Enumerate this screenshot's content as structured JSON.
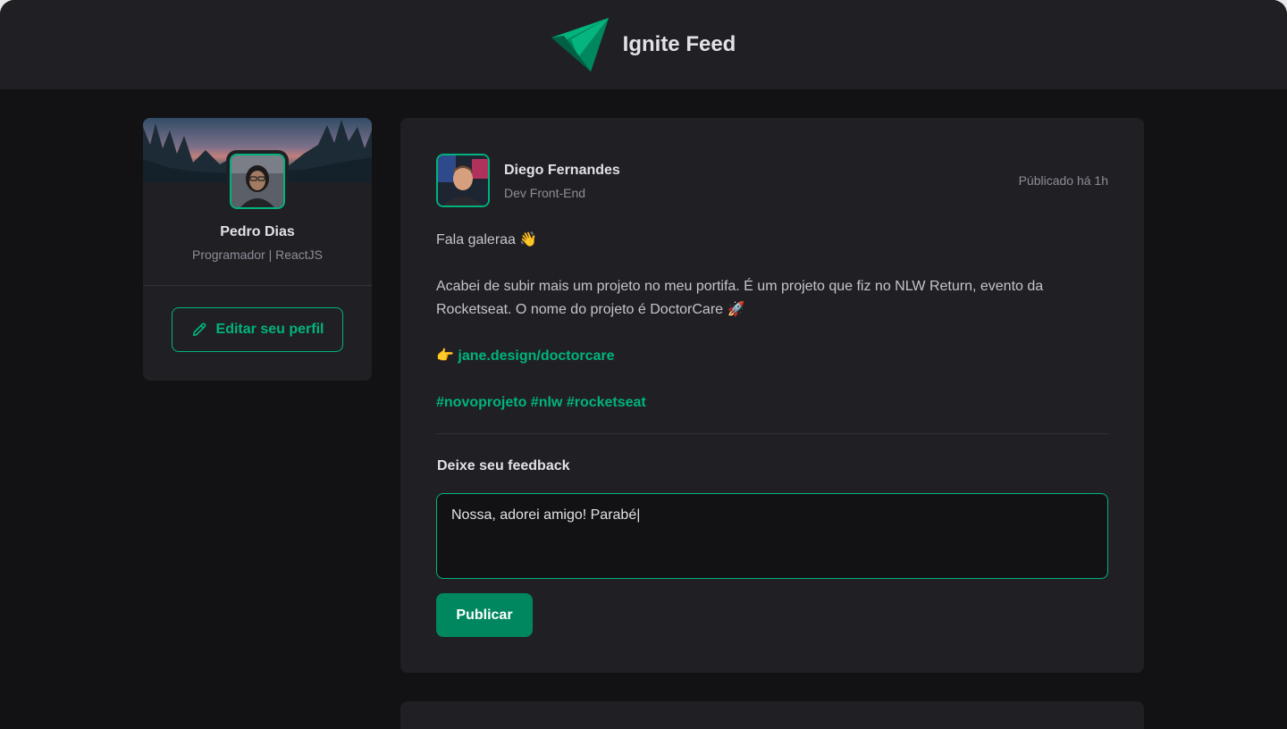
{
  "header": {
    "title": "Ignite Feed",
    "logo_icon": "triangle-logo-icon"
  },
  "profile": {
    "name": "Pedro Dias",
    "role": "Programador | ReactJS",
    "edit_label": "Editar seu perfil",
    "edit_icon": "pencil-icon"
  },
  "post": {
    "author": {
      "name": "Diego Fernandes",
      "role": "Dev Front-End"
    },
    "published": "Públicado há 1h",
    "content": {
      "greeting": "Fala galeraa 👋",
      "body": "Acabei de subir mais um projeto no meu portifa. É um projeto que fiz no NLW Return, evento da Rocketseat. O nome do projeto é DoctorCare 🚀",
      "link_prefix": "👉",
      "link": "jane.design/doctorcare",
      "hashtags": [
        "#novoprojeto",
        "#nlw",
        "#rocketseat"
      ]
    },
    "feedback": {
      "title": "Deixe seu feedback",
      "value": "Nossa, adorei amigo! Parabé|",
      "publish_label": "Publicar"
    }
  },
  "colors": {
    "background": "#121214",
    "surface": "#202024",
    "accent": "#00b37e",
    "button": "#00875f"
  }
}
